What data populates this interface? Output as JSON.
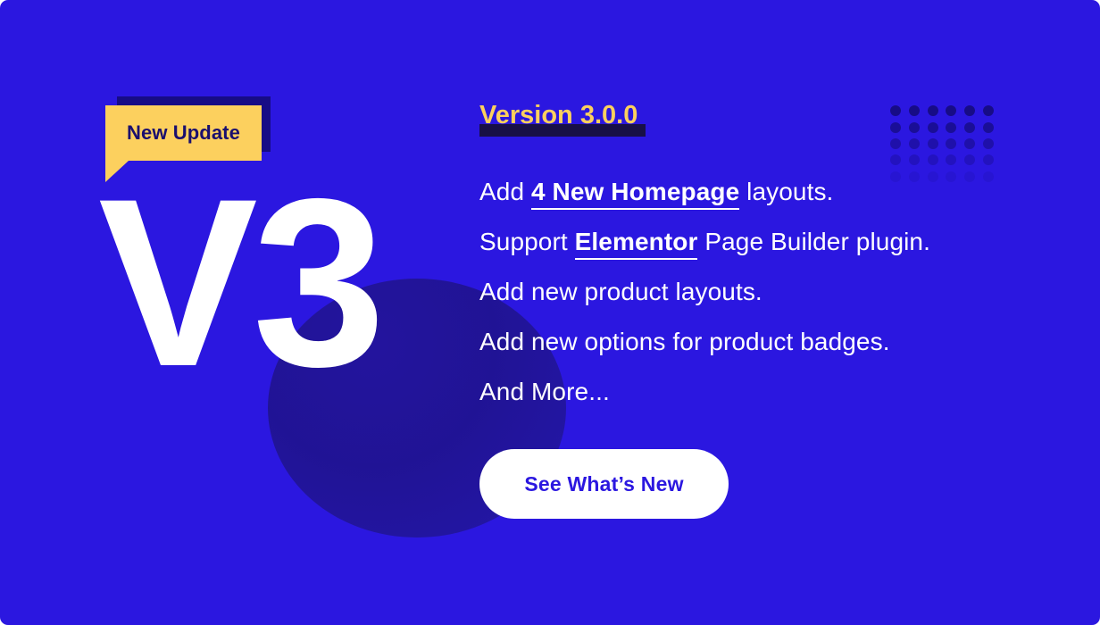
{
  "banner": {
    "background_color": "#2b17e0",
    "accent_yellow": "#fcd05e",
    "accent_navy": "#170c86",
    "text_color": "#ffffff"
  },
  "badge": {
    "label": "New Update",
    "text_color": "#1a0f6e",
    "fill_color": "#fcd05e",
    "shadow_color": "#170c86"
  },
  "version_mark": {
    "text": "V3"
  },
  "version_heading": {
    "text": "Version 3.0.0",
    "color": "#fcd05e",
    "highlight_color": "#181046"
  },
  "features": [
    {
      "prefix": "Add ",
      "emphasis": "4 New Homepage",
      "suffix": " layouts."
    },
    {
      "prefix": "Support ",
      "emphasis": "Elementor",
      "suffix": " Page Builder plugin."
    },
    {
      "prefix": "Add new product layouts.",
      "emphasis": "",
      "suffix": ""
    },
    {
      "prefix": "Add new options for product badges.",
      "emphasis": "",
      "suffix": ""
    },
    {
      "prefix": "And More...",
      "emphasis": "",
      "suffix": ""
    }
  ],
  "cta": {
    "label": "See What’s New",
    "text_color": "#2b17e0",
    "background_color": "#ffffff"
  },
  "decor": {
    "dot_grid": {
      "columns": 6,
      "rows": 5,
      "dot_color": "#170c86"
    },
    "circle": {
      "color": "#201392"
    }
  }
}
